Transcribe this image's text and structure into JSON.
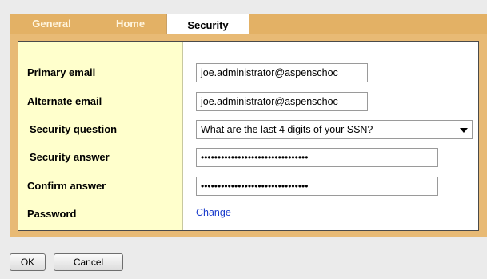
{
  "tabs": [
    {
      "label": "General",
      "active": false
    },
    {
      "label": "Home",
      "active": false
    },
    {
      "label": "Security",
      "active": true
    }
  ],
  "form": {
    "primary_email": {
      "label": "Primary email",
      "value": "joe.administrator@aspenschoc"
    },
    "alternate_email": {
      "label": "Alternate email",
      "value": "joe.administrator@aspenschoc"
    },
    "security_question": {
      "label": "Security question",
      "value": "What are the last 4 digits of your SSN?"
    },
    "security_answer": {
      "label": "Security answer",
      "value": "••••••••••••••••••••••••••••••••"
    },
    "confirm_answer": {
      "label": "Confirm answer",
      "value": "••••••••••••••••••••••••••••••••"
    },
    "password": {
      "label": "Password",
      "link": "Change"
    }
  },
  "buttons": {
    "ok": "OK",
    "cancel": "Cancel"
  },
  "colors": {
    "tab_bar": "#e3b165",
    "label_column": "#ffffcc",
    "link": "#1a3ccc"
  }
}
